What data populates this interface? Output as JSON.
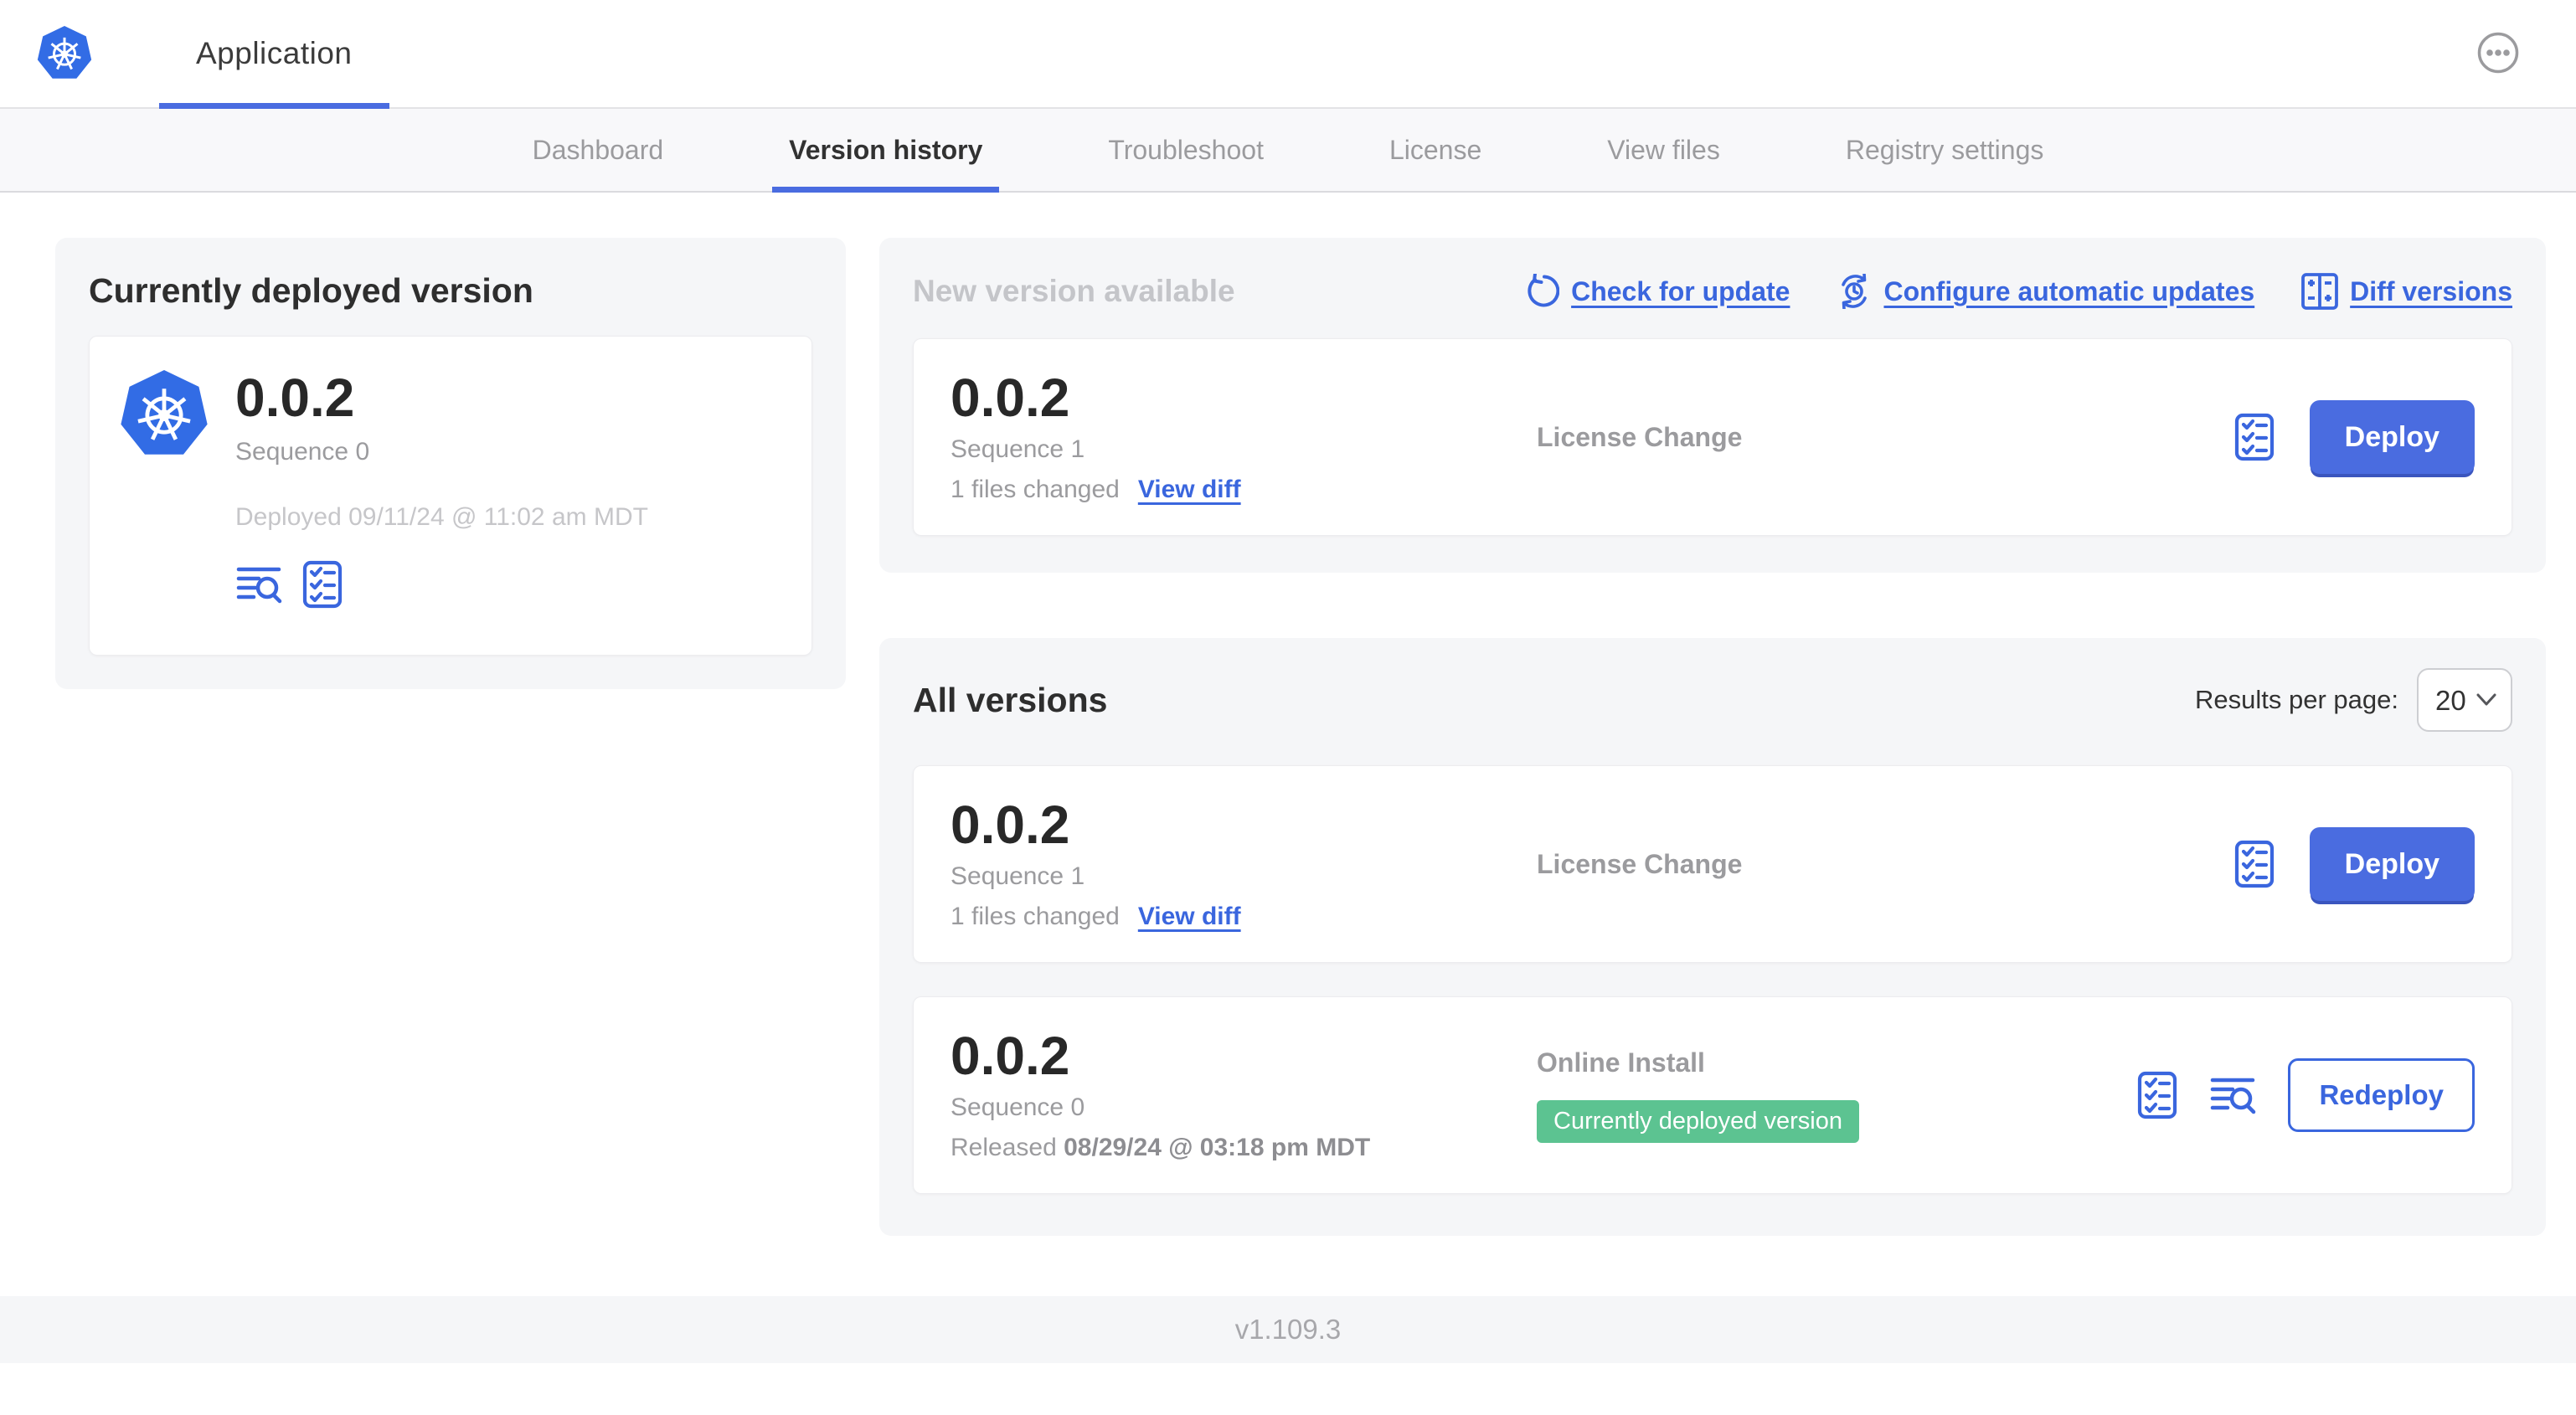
{
  "header": {
    "app_tab_label": "Application",
    "menu_icon": "ellipsis-circle-icon"
  },
  "nav": {
    "tabs": [
      {
        "label": "Dashboard",
        "active": false
      },
      {
        "label": "Version history",
        "active": true
      },
      {
        "label": "Troubleshoot",
        "active": false
      },
      {
        "label": "License",
        "active": false
      },
      {
        "label": "View files",
        "active": false
      },
      {
        "label": "Registry settings",
        "active": false
      }
    ]
  },
  "currently_deployed": {
    "title": "Currently deployed version",
    "version": "0.0.2",
    "sequence": "Sequence 0",
    "deployed_at": "Deployed 09/11/24 @ 11:02 am MDT",
    "icons": [
      "logs-icon",
      "preflight-checklist-icon"
    ]
  },
  "new_version": {
    "title": "New version available",
    "links": {
      "check_for_update": "Check for update",
      "configure_automatic_updates": "Configure automatic updates",
      "diff_versions": "Diff versions"
    },
    "card": {
      "version": "0.0.2",
      "sequence": "Sequence 1",
      "files_changed": "1 files changed",
      "view_diff": "View diff",
      "type": "License Change",
      "action_label": "Deploy"
    }
  },
  "all_versions": {
    "title": "All versions",
    "results_per_page_label": "Results per page:",
    "results_per_page_value": "20",
    "rows": [
      {
        "version": "0.0.2",
        "sequence": "Sequence 1",
        "files_changed": "1 files changed",
        "view_diff": "View diff",
        "type": "License Change",
        "badge": "",
        "action_label": "Deploy"
      },
      {
        "version": "0.0.2",
        "sequence": "Sequence 0",
        "released_prefix": "Released",
        "released_date": "08/29/24 @ 03:18 pm MDT",
        "type": "Online Install",
        "badge": "Currently deployed version",
        "action_label": "Redeploy"
      }
    ]
  },
  "footer": {
    "version": "v1.109.3"
  },
  "colors": {
    "link_blue": "#3a66de",
    "button_blue": "#4a6ce0",
    "kubernetes_blue": "#326ce5",
    "badge_green": "#5cc391",
    "panel_gray": "#f5f6f8"
  }
}
